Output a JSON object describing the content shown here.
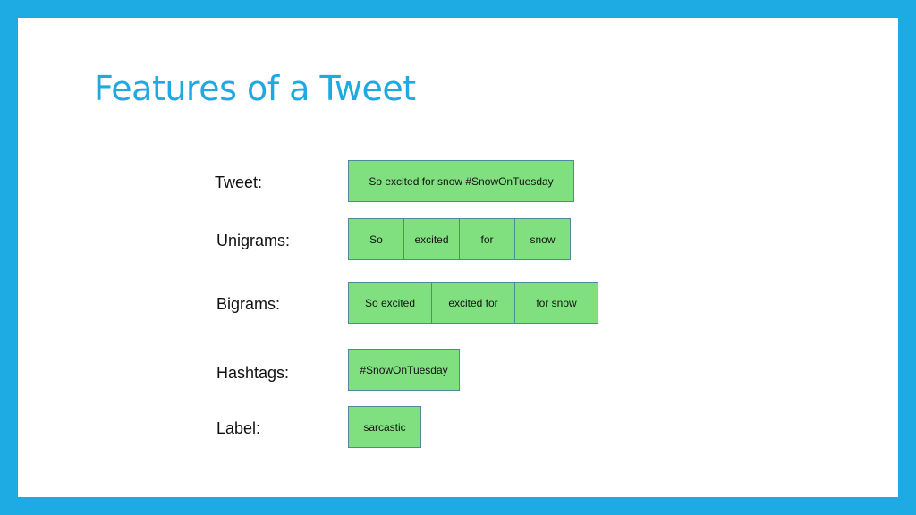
{
  "slide": {
    "title": "Features of a Tweet",
    "accent_color": "#1fa9e1",
    "box_fill_color": "#80e07f",
    "box_border_color": "#4c8a9c"
  },
  "rows": {
    "tweet": {
      "label": "Tweet:",
      "items": [
        "So excited for snow #SnowOnTuesday"
      ]
    },
    "unigrams": {
      "label": "Unigrams:",
      "items": [
        "So",
        "excited",
        "for",
        "snow"
      ]
    },
    "bigrams": {
      "label": "Bigrams:",
      "items": [
        "So excited",
        "excited for",
        "for snow"
      ]
    },
    "hashtags": {
      "label": "Hashtags:",
      "items": [
        "#SnowOnTuesday"
      ]
    },
    "label": {
      "label": "Label:",
      "items": [
        "sarcastic"
      ]
    }
  }
}
